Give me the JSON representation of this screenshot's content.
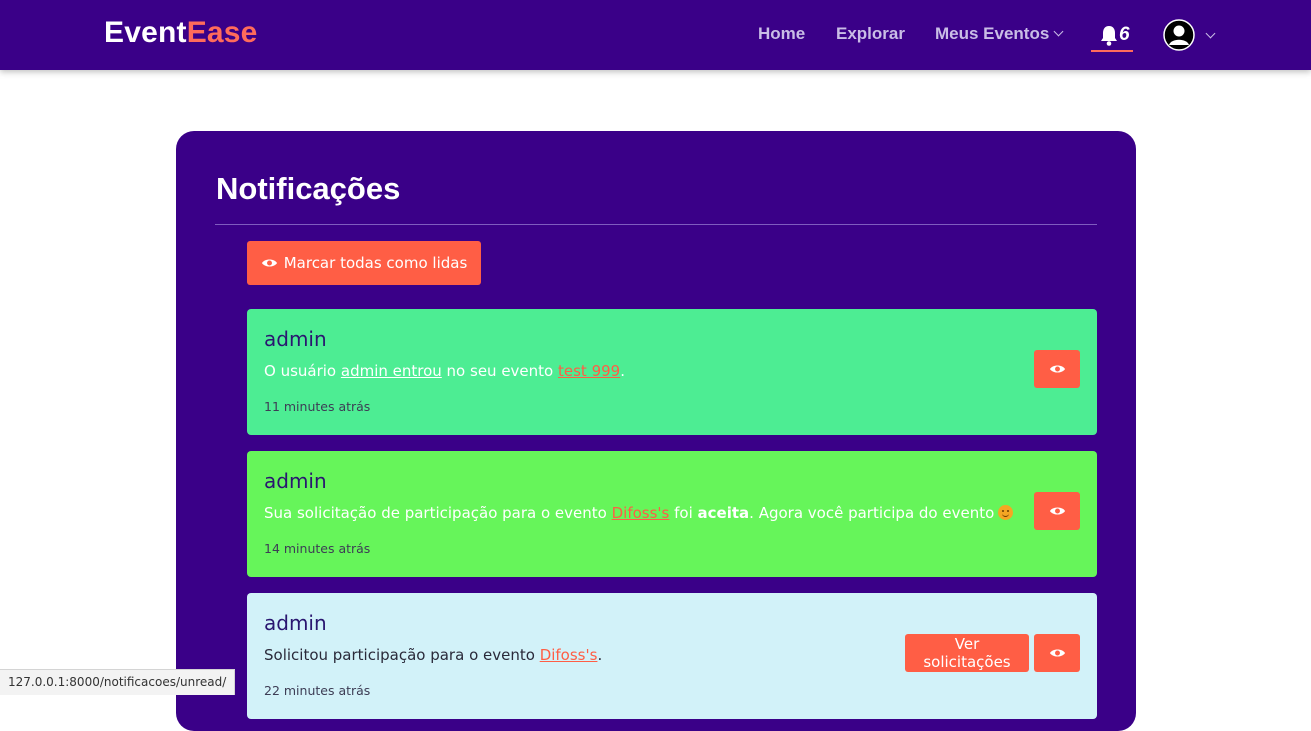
{
  "brand": {
    "part1": "Event",
    "part2": "Ease"
  },
  "nav": {
    "home": "Home",
    "explore": "Explorar",
    "my_events": "Meus Eventos",
    "notification_count": "6"
  },
  "page": {
    "title": "Notificações",
    "mark_all_label": "Marcar todas como lidas"
  },
  "colors": {
    "navbar": "#3a0088",
    "accent": "#ff5e45",
    "card1": "#4ded93",
    "card2": "#66f55a",
    "card3": "#d2f2f9"
  },
  "notifications": [
    {
      "user": "admin",
      "msg_pre": "O usuário ",
      "msg_link1": "admin entrou",
      "msg_mid": " no seu evento ",
      "msg_link2": "test 999",
      "msg_end": ".",
      "time": "11 minutes atrás"
    },
    {
      "user": "admin",
      "msg_pre": "Sua solicitação de participação para o evento ",
      "msg_link": "Difoss's",
      "msg_mid": " foi ",
      "msg_bold": "aceita",
      "msg_end": ". Agora você participa do evento",
      "time": "14 minutes atrás"
    },
    {
      "user": "admin",
      "msg_pre": "Solicitou participação para o evento ",
      "msg_link": "Difoss's",
      "msg_end": ".",
      "time": "22 minutes atrás",
      "requests_label": "Ver solicitações"
    }
  ],
  "status_url": "127.0.0.1:8000/notificacoes/unread/"
}
